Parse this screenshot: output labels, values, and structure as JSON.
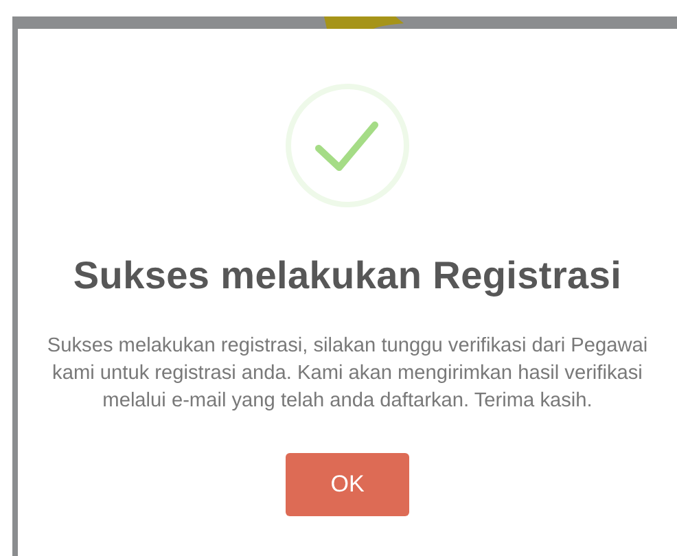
{
  "dialog": {
    "title": "Sukses melakukan Registrasi",
    "message": "Sukses melakukan registrasi, silakan tunggu verifikasi dari Pegawai kami untuk registrasi anda. Kami akan mengirimkan hasil verifikasi melalui e-mail yang telah anda daftarkan. Terima kasih.",
    "button": {
      "label": "OK"
    }
  }
}
